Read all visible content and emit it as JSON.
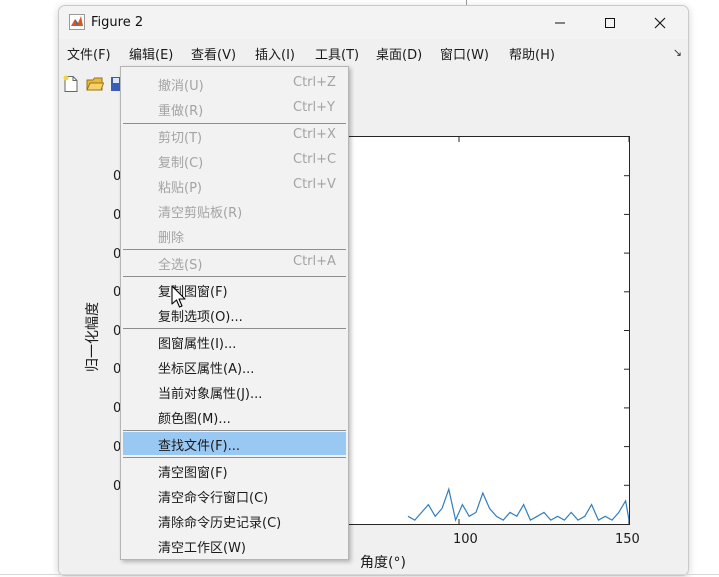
{
  "window": {
    "title": "Figure 2"
  },
  "menubar": {
    "items": [
      "文件(F)",
      "编辑(E)",
      "查看(V)",
      "插入(I)",
      "工具(T)",
      "桌面(D)",
      "窗口(W)",
      "帮助(H)"
    ],
    "overflow_arrow": "↘"
  },
  "edit_menu": {
    "items": [
      {
        "label": "撤消(U)",
        "shortcut": "Ctrl+Z",
        "enabled": false
      },
      {
        "label": "重做(R)",
        "shortcut": "Ctrl+Y",
        "enabled": false
      },
      {
        "label": "剪切(T)",
        "shortcut": "Ctrl+X",
        "enabled": false
      },
      {
        "label": "复制(C)",
        "shortcut": "Ctrl+C",
        "enabled": false
      },
      {
        "label": "粘贴(P)",
        "shortcut": "Ctrl+V",
        "enabled": false
      },
      {
        "label": "清空剪贴板(R)",
        "shortcut": "",
        "enabled": false
      },
      {
        "label": "删除",
        "shortcut": "",
        "enabled": false
      },
      {
        "label": "全选(S)",
        "shortcut": "Ctrl+A",
        "enabled": false
      },
      {
        "label": "复制图窗(F)",
        "shortcut": "",
        "enabled": true
      },
      {
        "label": "复制选项(O)...",
        "shortcut": "",
        "enabled": true
      },
      {
        "label": "图窗属性(I)...",
        "shortcut": "",
        "enabled": true
      },
      {
        "label": "坐标区属性(A)...",
        "shortcut": "",
        "enabled": true
      },
      {
        "label": "当前对象属性(J)...",
        "shortcut": "",
        "enabled": true
      },
      {
        "label": "颜色图(M)...",
        "shortcut": "",
        "enabled": true
      },
      {
        "label": "查找文件(F)...",
        "shortcut": "",
        "enabled": true,
        "highlighted": true
      },
      {
        "label": "清空图窗(F)",
        "shortcut": "",
        "enabled": true
      },
      {
        "label": "清空命令行窗口(C)",
        "shortcut": "",
        "enabled": true
      },
      {
        "label": "清除命令历史记录(C)",
        "shortcut": "",
        "enabled": true
      },
      {
        "label": "清空工作区(W)",
        "shortcut": "",
        "enabled": true
      }
    ]
  },
  "plot": {
    "xlabel": "角度(°)",
    "ylabel": "归一化幅度",
    "x_tick_labels": [
      "100",
      "150"
    ],
    "y_tick_partial": [
      "0",
      "0",
      "0",
      "0",
      "0",
      "0",
      "0",
      "0",
      "0"
    ]
  },
  "chart_data": {
    "type": "line",
    "x": [
      85,
      87,
      89,
      91,
      93,
      95,
      97,
      99,
      101,
      103,
      105,
      107,
      109,
      111,
      113,
      115,
      117,
      119,
      121,
      123,
      125,
      127,
      129,
      131,
      133,
      135,
      137,
      139,
      141,
      143,
      145,
      147,
      149,
      150
    ],
    "y": [
      0.02,
      0.01,
      0.03,
      0.05,
      0.02,
      0.04,
      0.09,
      0.01,
      0.05,
      0.02,
      0.03,
      0.08,
      0.04,
      0.02,
      0.01,
      0.03,
      0.02,
      0.05,
      0.01,
      0.02,
      0.03,
      0.01,
      0.02,
      0.01,
      0.03,
      0.01,
      0.02,
      0.05,
      0.01,
      0.02,
      0.01,
      0.03,
      0.06,
      0.01
    ],
    "xlim": [
      50,
      150
    ],
    "ylim": [
      0,
      1
    ],
    "color": "#2f7ec1",
    "xlabel": "角度(°)",
    "ylabel": "归一化幅度"
  },
  "colors": {
    "highlight": "#99c9f3",
    "line": "#2f7ec1",
    "disabled_text": "#a3a3a3"
  }
}
